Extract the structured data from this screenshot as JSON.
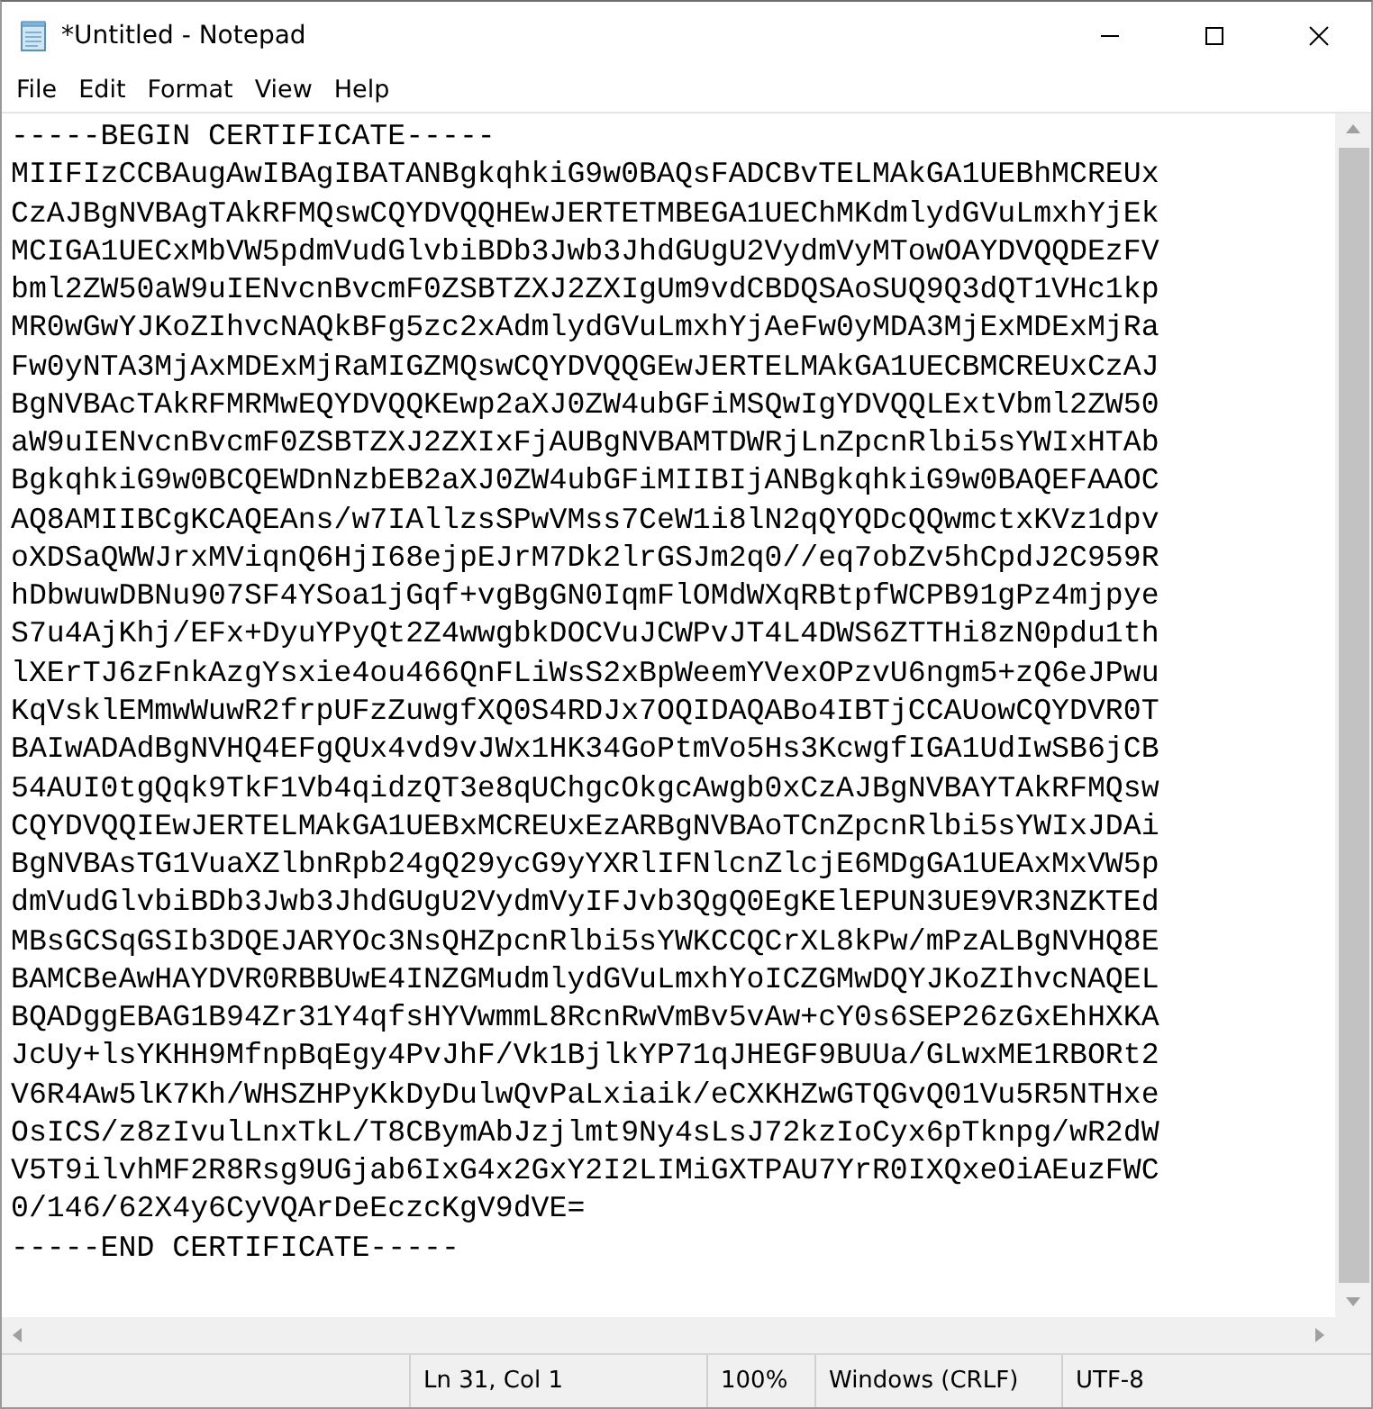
{
  "window": {
    "title": "*Untitled - Notepad"
  },
  "menu": [
    "File",
    "Edit",
    "Format",
    "View",
    "Help"
  ],
  "editor": {
    "lines": [
      "-----BEGIN CERTIFICATE-----",
      "MIIFIzCCBAugAwIBAgIBATANBgkqhkiG9w0BAQsFADCBvTELMAkGA1UEBhMCREUx",
      "CzAJBgNVBAgTAkRFMQswCQYDVQQHEwJERTETMBEGA1UEChMKdmlydGVuLmxhYjEk",
      "MCIGA1UECxMbVW5pdmVudGlvbiBDb3Jwb3JhdGUgU2VydmVyMTowOAYDVQQDEzFV",
      "bml2ZW50aW9uIENvcnBvcmF0ZSBTZXJ2ZXIgUm9vdCBDQSAoSUQ9Q3dQT1VHc1kp",
      "MR0wGwYJKoZIhvcNAQkBFg5zc2xAdmlydGVuLmxhYjAeFw0yMDA3MjExMDExMjRa",
      "Fw0yNTA3MjAxMDExMjRaMIGZMQswCQYDVQQGEwJERTELMAkGA1UECBMCREUxCzAJ",
      "BgNVBAcTAkRFMRMwEQYDVQQKEwp2aXJ0ZW4ubGFiMSQwIgYDVQQLExtVbml2ZW50",
      "aW9uIENvcnBvcmF0ZSBTZXJ2ZXIxFjAUBgNVBAMTDWRjLnZpcnRlbi5sYWIxHTAb",
      "BgkqhkiG9w0BCQEWDnNzbEB2aXJ0ZW4ubGFiMIIBIjANBgkqhkiG9w0BAQEFAAOC",
      "AQ8AMIIBCgKCAQEAns/w7IAllzsSPwVMss7CeW1i8lN2qQYQDcQQwmctxKVz1dpv",
      "oXDSaQWWJrxMViqnQ6HjI68ejpEJrM7Dk2lrGSJm2q0//eq7obZv5hCpdJ2C959R",
      "hDbwuwDBNu907SF4YSoa1jGqf+vgBgGN0IqmFlOMdWXqRBtpfWCPB91gPz4mjpye",
      "S7u4AjKhj/EFx+DyuYPyQt2Z4wwgbkDOCVuJCWPvJT4L4DWS6ZTTHi8zN0pdu1th",
      "lXErTJ6zFnkAzgYsxie4ou466QnFLiWsS2xBpWeemYVexOPzvU6ngm5+zQ6eJPwu",
      "KqVsklEMmwWuwR2frpUFzZuwgfXQ0S4RDJx7OQIDAQABo4IBTjCCAUowCQYDVR0T",
      "BAIwADAdBgNVHQ4EFgQUx4vd9vJWx1HK34GoPtmVo5Hs3KcwgfIGA1UdIwSB6jCB",
      "54AUI0tgQqk9TkF1Vb4qidzQT3e8qUChgcOkgcAwgb0xCzAJBgNVBAYTAkRFMQsw",
      "CQYDVQQIEwJERTELMAkGA1UEBxMCREUxEzARBgNVBAoTCnZpcnRlbi5sYWIxJDAi",
      "BgNVBAsTG1VuaXZlbnRpb24gQ29ycG9yYXRlIFNlcnZlcjE6MDgGA1UEAxMxVW5p",
      "dmVudGlvbiBDb3Jwb3JhdGUgU2VydmVyIFJvb3QgQ0EgKElEPUN3UE9VR3NZKTEd",
      "MBsGCSqGSIb3DQEJARYOc3NsQHZpcnRlbi5sYWKCCQCrXL8kPw/mPzALBgNVHQ8E",
      "BAMCBeAwHAYDVR0RBBUwE4INZGMudmlydGVuLmxhYoICZGMwDQYJKoZIhvcNAQEL",
      "BQADggEBAG1B94Zr31Y4qfsHYVwmmL8RcnRwVmBv5vAw+cY0s6SEP26zGxEhHXKA",
      "JcUy+lsYKHH9MfnpBqEgy4PvJhF/Vk1BjlkYP71qJHEGF9BUUa/GLwxME1RBORt2",
      "V6R4Aw5lK7Kh/WHSZHPyKkDyDulwQvPaLxiaik/eCXKHZwGTQGvQ01Vu5R5NTHxe",
      "OsICS/z8zIvulLnxTkL/T8CBymAbJzjlmt9Ny4sLsJ72kzIoCyx6pTknpg/wR2dW",
      "V5T9ilvhMF2R8Rsg9UGjab6IxG4x2GxY2I2LIMiGXTPAU7YrR0IXQxeOiAEuzFWC",
      "0/146/62X4y6CyVQArDeEczcKgV9dVE=",
      "-----END CERTIFICATE-----"
    ]
  },
  "status_bar": {
    "position": "Ln 31, Col 1",
    "zoom": "100%",
    "line_ending": "Windows (CRLF)",
    "encoding": "UTF-8"
  }
}
